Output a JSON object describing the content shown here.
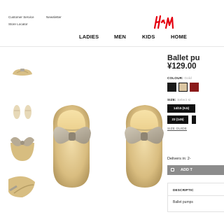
{
  "header": {
    "links": [
      "Customer Service",
      "Newsletter",
      "Store Locator"
    ],
    "logo": "H&M",
    "nav": [
      "LADIES",
      "MEN",
      "KIDS",
      "HOME"
    ]
  },
  "product": {
    "title": "Ballet pu",
    "price": "¥129.00",
    "colour_label": "COLOUR:",
    "colour_value": "Gold",
    "swatches": [
      "#1a1a1a",
      "#d9c4a0",
      "#8b1a1a"
    ],
    "size_label": "SIZE:",
    "size_value": "Select si",
    "sizes": [
      "14/15 (9.5)",
      "23 (145)"
    ],
    "size_guide": "SIZE GUIDE",
    "delivery": "Delivers in: 2-",
    "add_button": "ADD T",
    "description_header": "DESCRIPTIC",
    "description_text": "Ballet pumps"
  }
}
